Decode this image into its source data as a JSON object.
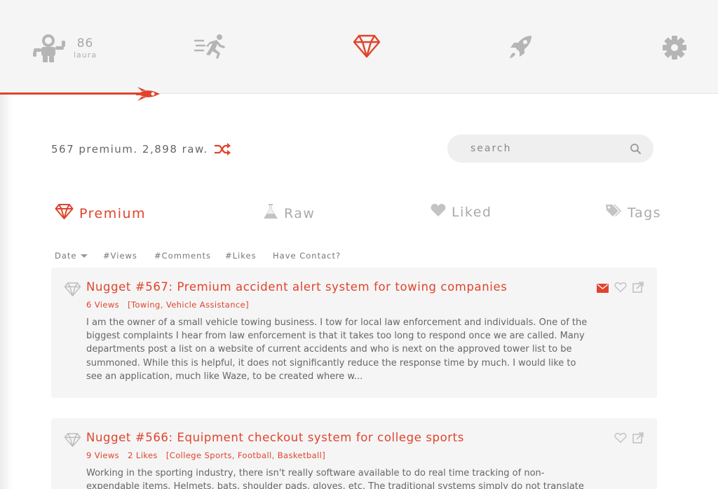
{
  "header": {
    "user": {
      "score": "86",
      "name": "laura",
      "icon": "astronaut-icon"
    },
    "nav_icons": [
      "astronaut-icon",
      "runner-icon",
      "diamond-icon",
      "rocket-icon",
      "gear-icon"
    ],
    "active_nav": "diamond-icon",
    "progress_fraction": 0.2
  },
  "stats": {
    "text": "567 premium. 2,898 raw.",
    "shuffle_icon": "shuffle-icon"
  },
  "search": {
    "placeholder": "search"
  },
  "tabs": [
    {
      "label": "Premium",
      "icon": "diamond-icon",
      "active": true
    },
    {
      "label": "Raw",
      "icon": "flask-icon",
      "active": false
    },
    {
      "label": "Liked",
      "icon": "heart-icon",
      "active": false
    },
    {
      "label": "Tags",
      "icon": "tags-icon",
      "active": false
    }
  ],
  "sort": [
    "Date",
    "#Views",
    "#Comments",
    "#Likes",
    "Have Contact?"
  ],
  "nuggets": [
    {
      "title": "Nugget #567: Premium accident alert system for towing companies",
      "views": "6 Views",
      "likes": "",
      "tags": "[Towing, Vehicle Assistance]",
      "has_contact": true,
      "body": "I am the owner of a small vehicle towing business. I tow for local law enforcement and individuals. One of the biggest complaints I hear from law enforcement is that it takes too long to respond once we are called. Many departments post a list on a website of current accidents and who is next on the approved tower list to be summoned. While this is helpful, it does not significantly reduce the response time by much. I would like to see an application, much like Waze, to be created where w..."
    },
    {
      "title": "Nugget #566: Equipment checkout system for college sports",
      "views": "9 Views",
      "likes": "2 Likes",
      "tags": "[College Sports, Football, Basketball]",
      "has_contact": false,
      "body": "Working in the sporting industry, there isn't really software available to do real time tracking of non-expendable items. Helmets, bats, shoulder pads, gloves, etc. The traditional systems simply do not translate into the sporting"
    }
  ],
  "colors": {
    "accent": "#e0442c",
    "icon_gray": "#b5b5b5",
    "card_bg": "#f5f5f5"
  }
}
